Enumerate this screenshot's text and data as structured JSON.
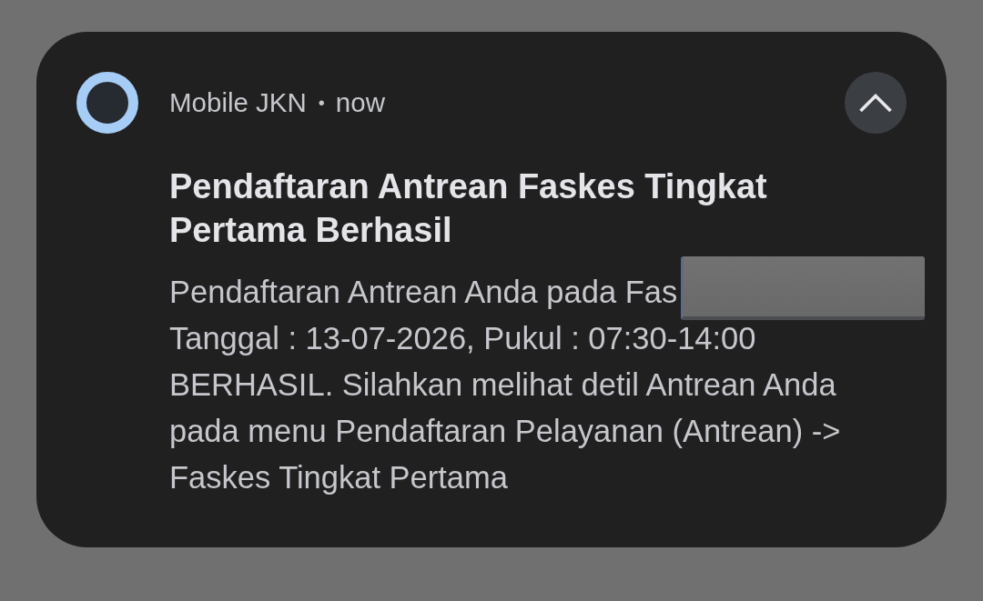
{
  "notification": {
    "app_name": "Mobile JKN",
    "separator": "•",
    "time": "now",
    "expanded": true,
    "title": "Pendaftaran Antrean Faskes Tingkat Pertama Berhasil",
    "body": {
      "lead": "Pendaftaran Antrean Anda pada Fas",
      "redacted": true,
      "lines": [
        "Tanggal : 13-07-2026, Pukul : 07:30-14:00",
        "BERHASIL. Silahkan melihat detil Antrean Anda",
        "pada menu Pendaftaran Pelayanan (Antrean) ->",
        "Faskes Tingkat Pertama"
      ]
    }
  }
}
